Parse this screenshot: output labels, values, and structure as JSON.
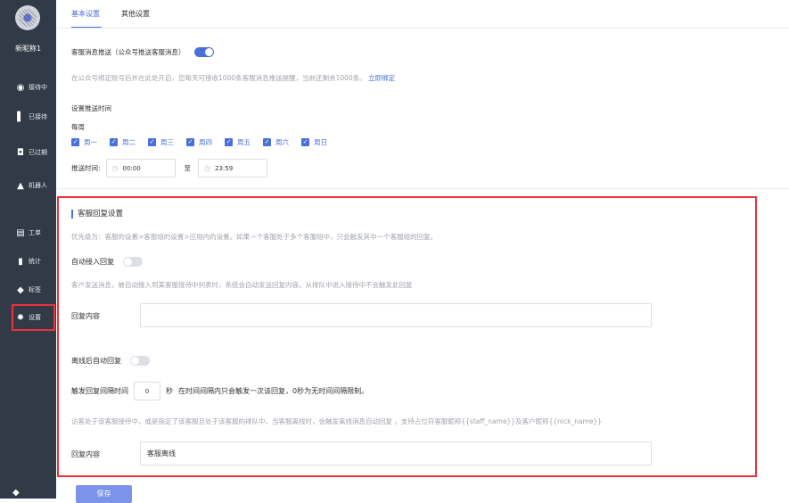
{
  "sidebar": {
    "nickname": "新昵称1",
    "items": [
      {
        "label": "接待中",
        "icon": "eye-icon"
      },
      {
        "label": "已接待",
        "icon": "thumb-icon"
      },
      {
        "label": "已过期",
        "icon": "clock-icon"
      },
      {
        "label": "机器人",
        "icon": "robot-icon"
      },
      {
        "label": "工单",
        "icon": "ticket-icon"
      },
      {
        "label": "统计",
        "icon": "bar-chart-icon"
      },
      {
        "label": "标签",
        "icon": "tag-icon"
      },
      {
        "label": "设置",
        "icon": "gear-icon"
      }
    ]
  },
  "tabs": [
    {
      "label": "基本设置",
      "active": true
    },
    {
      "label": "其他设置",
      "active": false
    }
  ],
  "push": {
    "label": "客服消息推送（公众号推送客服消息）",
    "enabled": true,
    "description": "在公众号绑定账号后并在此处开启，您每天可接收1000条客服消息推送提醒，当前还剩余1000条。",
    "bind_link": "立即绑定",
    "schedule_title": "设置推送时间",
    "repeat_label": "每周",
    "days": [
      "周一",
      "周二",
      "周三",
      "周四",
      "周五",
      "周六",
      "周日"
    ],
    "time_label": "推送时间:",
    "time_from": "00:00",
    "time_sep": "至",
    "time_to": "23:59"
  },
  "reply": {
    "section_title": "客服回复设置",
    "priority_note": "优先级为：客服的设置>客服组的设置>应用内的设置。如果一个客服处于多个客服组中，只会触发其中一个客服组的回复。",
    "auto_join_label": "自动接入回复",
    "auto_join_enabled": false,
    "auto_join_note": "客户发送消息，被自动接入到某客服接待中列表时，系统会自动发送回复内容。从排队中进入接待中不会触发此回复",
    "content_label": "回复内容",
    "content_value": "",
    "offline_label": "离线后自动回复",
    "offline_enabled": false,
    "interval_label": "触发回复间隔时间",
    "interval_value": "0",
    "interval_unit": "秒",
    "interval_note": "在时间间隔内只会触发一次该回复，0秒为无时间间隔限制。",
    "offline_note": "访客处于该客服接待中，或是指定了该客服且处于该客服的排队中，当客服离线时，会触发离线消息自动回复 。支持占位符客服昵称{{staff_name}}及客户昵称{{nick_name}}",
    "offline_content_label": "回复内容",
    "offline_content_value": "客服离线"
  },
  "submit_label": "保存"
}
